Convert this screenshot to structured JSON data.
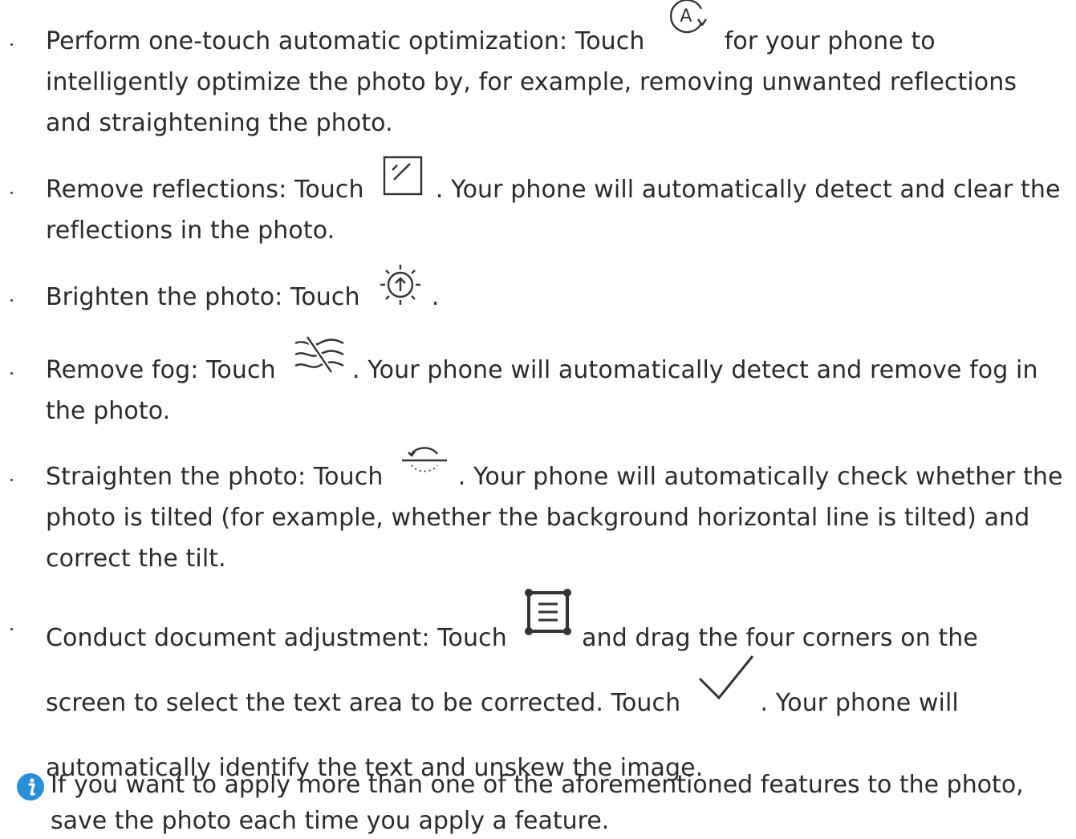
{
  "items": [
    {
      "before": "Perform one-touch automatic optimization: Touch",
      "icon": "auto-optimize-icon",
      "after": " for your phone to intelligently optimize the photo by, for example, removing unwanted reflections and straightening the photo."
    },
    {
      "before": "Remove reflections: Touch",
      "icon": "remove-reflection-icon",
      "after": ". Your phone will automatically detect and clear the reflections in the photo."
    },
    {
      "before": "Brighten the photo: Touch",
      "icon": "brighten-icon",
      "after": "."
    },
    {
      "before": "Remove fog: Touch",
      "icon": "defog-icon",
      "after": ". Your phone will automatically detect and remove fog in the photo."
    },
    {
      "before": "Straighten the photo: Touch",
      "icon": "straighten-icon",
      "after": ". Your phone will automatically check whether the photo is tilted (for example, whether the background horizontal line is tilted) and correct the tilt."
    },
    {
      "before": "Conduct document adjustment: Touch",
      "icon": "document-adjust-icon",
      "middle": " and drag the four corners on the screen to select the text area to be corrected. Touch",
      "icon2": "checkmark-icon",
      "after": ". Your phone will automatically identify the text and unskew the image."
    }
  ],
  "note": {
    "icon": "info-icon",
    "accent": "#2a8fd8",
    "text": "If you want to apply more than one of the aforementioned features to the photo, save the photo each time you apply a feature."
  }
}
